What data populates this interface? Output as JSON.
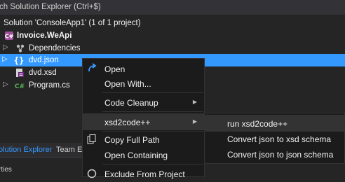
{
  "search": {
    "placeholder": "ch Solution Explorer (Ctrl+$)"
  },
  "tree": {
    "solution": "Solution 'ConsoleApp1' (1 of 1 project)",
    "project": "Invoice.WeApi",
    "dependencies": "Dependencies",
    "items": [
      "dvd.json",
      "dvd.xsd",
      "Program.cs"
    ]
  },
  "tabs": {
    "solution_explorer": "olution Explorer",
    "team_explorer": "Team E"
  },
  "properties_label": "rties",
  "context_menu": {
    "open": "Open",
    "open_with": "Open With...",
    "code_cleanup": "Code Cleanup",
    "xsd2code": "xsd2code++",
    "copy_full_path": "Copy Full Path",
    "open_containing": "Open Containing",
    "clipped_item": "Exclude From Project"
  },
  "submenu": {
    "run": "run xsd2code++",
    "json_to_xsd": "Convert json to xsd schema",
    "json_to_json": "Convert json to json schema"
  },
  "colors": {
    "selection": "#3399ff",
    "background": "#252526",
    "menu": "#1b1b1c",
    "menu_hover": "#333334"
  }
}
